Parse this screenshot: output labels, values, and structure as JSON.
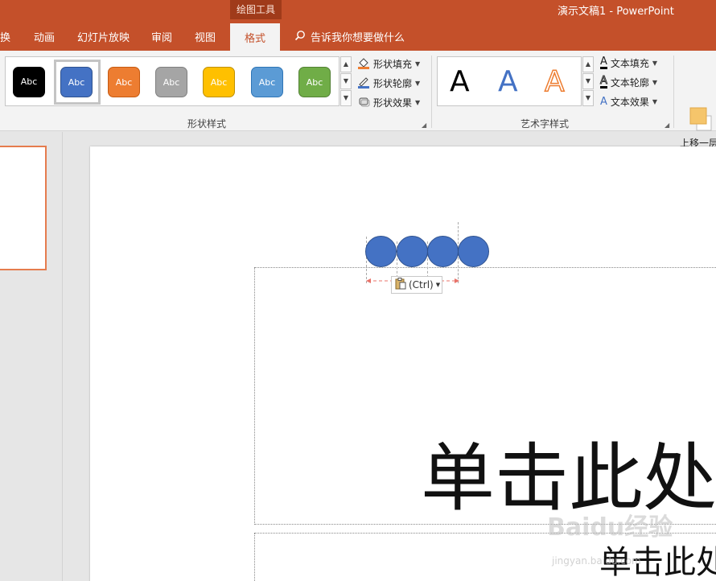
{
  "window": {
    "context_tab_group": "绘图工具",
    "app_title": "演示文稿1  -  PowerPoint"
  },
  "tabs": [
    {
      "label": "换"
    },
    {
      "label": "动画"
    },
    {
      "label": "幻灯片放映"
    },
    {
      "label": "审阅"
    },
    {
      "label": "视图"
    },
    {
      "label": "格式",
      "active": true
    }
  ],
  "tell_me": {
    "placeholder": "告诉我你想要做什么",
    "icon": "search-icon"
  },
  "ribbon": {
    "shape_styles": {
      "group_label": "形状样式",
      "chips": [
        {
          "label": "Abc",
          "color": "#000000"
        },
        {
          "label": "Abc",
          "color": "#4472c4",
          "selected": true
        },
        {
          "label": "Abc",
          "color": "#ed7d31"
        },
        {
          "label": "Abc",
          "color": "#a5a5a5"
        },
        {
          "label": "Abc",
          "color": "#ffc000"
        },
        {
          "label": "Abc",
          "color": "#5b9bd5"
        },
        {
          "label": "Abc",
          "color": "#70ad47"
        }
      ],
      "commands": [
        {
          "label": "形状填充",
          "icon": "paint-bucket-icon"
        },
        {
          "label": "形状轮廓",
          "icon": "pen-outline-icon"
        },
        {
          "label": "形状效果",
          "icon": "shape-effects-icon"
        }
      ]
    },
    "wordart_styles": {
      "group_label": "艺术字样式",
      "samples": [
        {
          "glyph": "A",
          "style": "black"
        },
        {
          "glyph": "A",
          "style": "blue"
        },
        {
          "glyph": "A",
          "style": "orange-outline"
        }
      ],
      "commands": [
        {
          "label": "文本填充",
          "icon": "text-fill-icon"
        },
        {
          "label": "文本轮廓",
          "icon": "text-outline-icon"
        },
        {
          "label": "文本效果",
          "icon": "text-effects-icon"
        }
      ]
    },
    "arrange": {
      "bring_forward_label": "上移一层"
    }
  },
  "canvas": {
    "paste_options_label": "(Ctrl)",
    "title_placeholder": "单击此处",
    "subtitle_placeholder": "单击此处",
    "watermark": "Baidu经验",
    "watermark_url": "jingyan.baidu.com",
    "shape_fill_color": "#4472c4",
    "shape_count": 4
  }
}
